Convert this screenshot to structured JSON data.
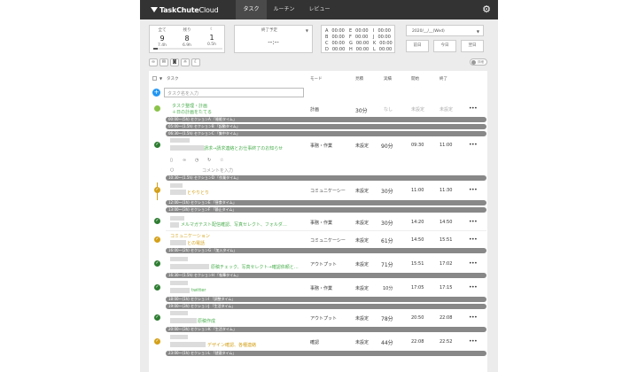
{
  "app": {
    "logo_bold": "TaskChute",
    "logo_thin": "Cloud"
  },
  "nav": {
    "tabs": [
      {
        "label": "タスク"
      },
      {
        "label": "ルーチン"
      },
      {
        "label": "レビュー"
      }
    ]
  },
  "summary": {
    "columns": [
      {
        "label": "全て",
        "count": "9",
        "time": "7.4h"
      },
      {
        "label": "残り",
        "count": "8",
        "time": "6.9h"
      },
      {
        "label": "",
        "count": "1",
        "time": "0.5h"
      }
    ],
    "progress": 0.07
  },
  "end_estimate": {
    "label": "終了予定",
    "value": "--:--"
  },
  "sections": [
    {
      "letter": "A",
      "value": "00:00"
    },
    {
      "letter": "B",
      "value": "00:00"
    },
    {
      "letter": "C",
      "value": "00:00"
    },
    {
      "letter": "D",
      "value": "00:00"
    },
    {
      "letter": "E",
      "value": "00:00"
    },
    {
      "letter": "F",
      "value": "00:00"
    },
    {
      "letter": "G",
      "value": "00:00"
    },
    {
      "letter": "H",
      "value": "00:00"
    },
    {
      "letter": "I",
      "value": "00:00"
    },
    {
      "letter": "J",
      "value": "00:00"
    },
    {
      "letter": "K",
      "value": "00:00"
    },
    {
      "letter": "L",
      "value": "00:00"
    }
  ],
  "date": {
    "value": "2020/__/__(Wed)",
    "prev": "前日",
    "today": "今日",
    "next": "翌日"
  },
  "toggle_label": "詳細",
  "headers": {
    "task": "タスク",
    "mode": "モード",
    "estimate": "見積",
    "actual": "実績",
    "start": "開始",
    "end": "終了"
  },
  "add_task_placeholder": "タスク名を入力",
  "first_task": {
    "name": "タスク整理・計画",
    "sub": "＋日の計画をたてる",
    "mode": "計画",
    "estimate": "30分",
    "actual": "なし",
    "start": "未設定",
    "end": "未設定"
  },
  "sections_bars": {
    "s1": "00:00〜(5h) セクションA 「睡眠タイム」",
    "s2": "05:00〜(1.5h) セクションB 「起動タイム」",
    "s3": "06:30〜(1.5h) セクションC 「集中タイム」",
    "s4": "10:30〜(1.5h) セクションD 「作業タイム」",
    "s5": "12:00〜(1h) セクションE 「昼食タイム」",
    "s6": "13:00〜(3h) セクションF 「静止タイム」",
    "s7": "16:00〜(2h) セクションG 「加入タイム」",
    "s8": "16:30〜(1.5h) セクションH 「執筆タイム」",
    "s9": "18:00〜(1h) セクションI 「調整タイム」",
    "s10": "19:00〜(3h) セクションJ 「生活タイム」",
    "s11": "20:00〜(3h) セクションK 「生活タイム」",
    "s12": "23:00〜(1h) セクションL 「就寝タイム」"
  },
  "tasks": [
    {
      "name": "請求→請求連絡とお仕事終了のお知らせ",
      "mode": "事務・作業",
      "estimate": "未設定",
      "actual": "90分",
      "start": "09:30",
      "end": "11:00"
    },
    {
      "name": "とやりとり",
      "mode": "コミュニケーシー",
      "estimate": "未設定",
      "actual": "30分",
      "start": "11:00",
      "end": "11:30"
    },
    {
      "name": "メルマガテスト配信確認、写真セレクト、フォルダ…",
      "mode": "事務・作業",
      "estimate": "未設定",
      "actual": "30分",
      "start": "14:20",
      "end": "14:50"
    },
    {
      "name_line1": "コミュニケーション",
      "name_line2": "との電話",
      "mode": "コミュニケーシー",
      "estimate": "未設定",
      "actual": "61分",
      "start": "14:50",
      "end": "15:51"
    },
    {
      "name": "原稿チェック、写真セレクト→確認依頼と…",
      "mode": "アウトプット",
      "estimate": "未設定",
      "actual": "71分",
      "start": "15:51",
      "end": "17:02"
    },
    {
      "name": "twitter",
      "mode": "事務・作業",
      "estimate": "未設定",
      "actual": "10分",
      "start": "17:05",
      "end": "17:15"
    },
    {
      "name": "原稿作成",
      "mode": "アウトプット",
      "estimate": "未設定",
      "actual": "78分",
      "start": "20:50",
      "end": "22:08"
    },
    {
      "name": "デザイン確認、各種連絡",
      "mode": "確認",
      "estimate": "未設定",
      "actual": "44分",
      "start": "22:08",
      "end": "22:52"
    }
  ],
  "comment_placeholder": "コメントを入力",
  "colors": {
    "accent": "#2196f3",
    "done": "#2e7d32",
    "doing": "#d4a017",
    "task_green": "#4caf50",
    "task_orange": "#d4a017",
    "section_bar": "#888888"
  }
}
